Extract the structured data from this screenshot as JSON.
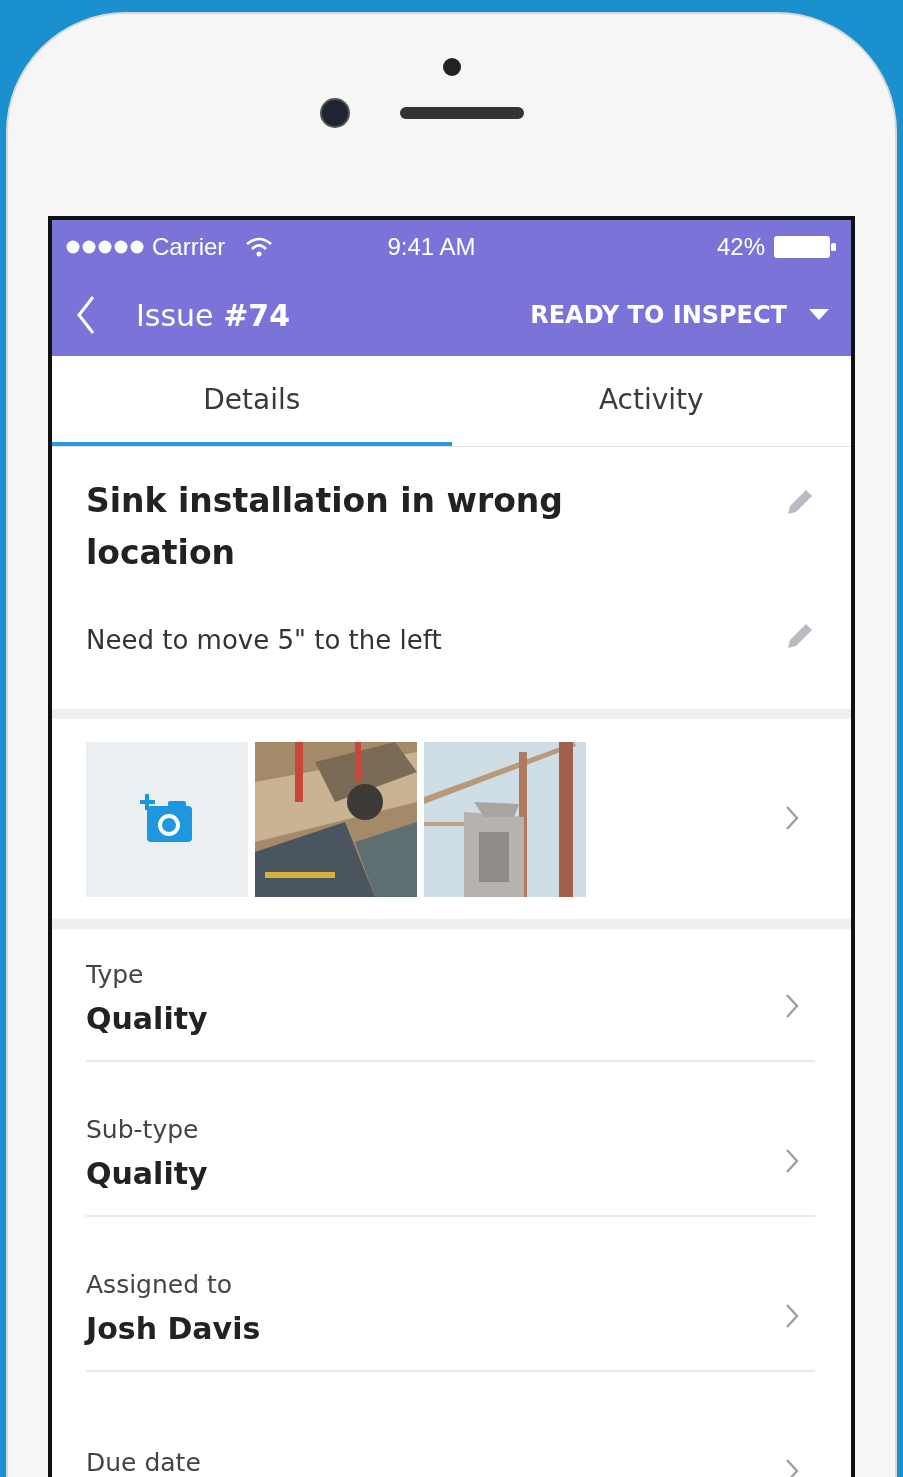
{
  "status_bar": {
    "carrier": "Carrier",
    "time": "9:41 AM",
    "battery": "42%"
  },
  "nav": {
    "title": "Issue **#74**",
    "status": "READY TO INSPECT"
  },
  "tabs": [
    {
      "label": "Details",
      "selected": true
    },
    {
      "label": "Activity",
      "selected": false
    }
  ],
  "issue": {
    "title": "Sink installation in wrong location",
    "description": "Need to move 5\" to the left"
  },
  "photos": [
    {
      "kind": "add"
    },
    {
      "kind": "picture"
    },
    {
      "kind": "picture"
    }
  ],
  "fields": [
    {
      "label": "Type",
      "value": "Quality"
    },
    {
      "label": "Sub-type",
      "value": "Quality"
    },
    {
      "label": "Assigned to",
      "value": "Josh Davis"
    },
    {
      "label": "Due date"
    }
  ]
}
